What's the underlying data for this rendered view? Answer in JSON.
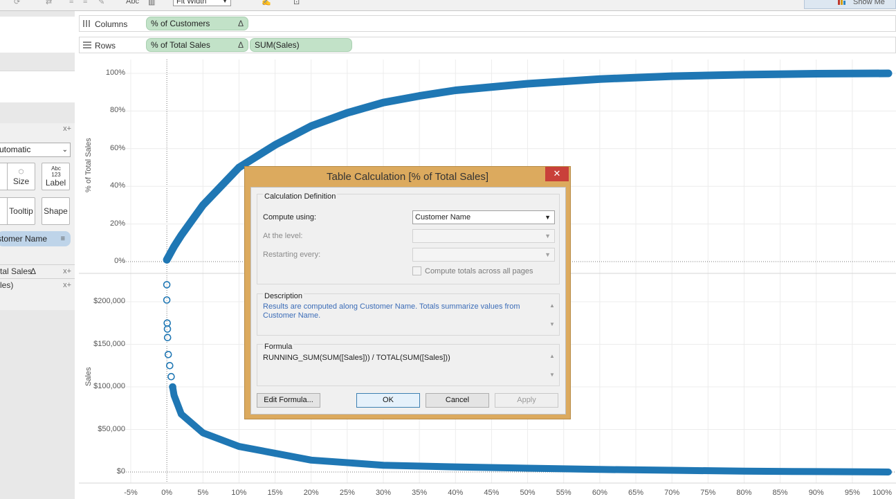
{
  "toolbar": {
    "fit_label": "Fit Width",
    "show_me_label": "Show Me",
    "abc_label": "Abc"
  },
  "left_panel": {
    "mark_type": "utomatic",
    "mark_buttons": [
      {
        "label": "Size",
        "icon": "size-icon"
      },
      {
        "label": "Label",
        "icon": "label-icon",
        "icon_text": "Abc 123"
      },
      {
        "label": "Tooltip",
        "icon": "tooltip-icon"
      },
      {
        "label": "Shape",
        "icon": "shape-icon"
      }
    ],
    "detail_pill": "stomer Name",
    "row_fields": [
      "tal Sales",
      "les)"
    ],
    "delta_glyph": "Δ",
    "add_glyph": "x+"
  },
  "shelves": {
    "columns_label": "Columns",
    "rows_label": "Rows",
    "columns_pills": [
      {
        "label": "% of Customers",
        "delta": "Δ"
      }
    ],
    "rows_pills": [
      {
        "label": "% of Total Sales",
        "delta": "Δ"
      },
      {
        "label": "SUM(Sales)",
        "delta": ""
      }
    ]
  },
  "view": {
    "top_axis_title": "% of Total Sales",
    "bottom_axis_title": "Sales",
    "top_y_ticks": [
      "100%",
      "80%",
      "60%",
      "40%",
      "20%",
      "0%"
    ],
    "bottom_y_ticks": [
      "$200,000",
      "$150,000",
      "$100,000",
      "$50,000",
      "$0"
    ],
    "x_ticks": [
      "-5%",
      "0%",
      "5%",
      "10%",
      "15%",
      "20%",
      "25%",
      "30%",
      "35%",
      "40%",
      "45%",
      "50%",
      "55%",
      "60%",
      "65%",
      "70%",
      "75%",
      "80%",
      "85%",
      "90%",
      "95%",
      "100%"
    ],
    "mark_color": "#1f77b4"
  },
  "chart_data": {
    "type": "scatter",
    "xlabel": "% of Customers",
    "series": [
      {
        "name": "% of Total Sales",
        "x": [
          0,
          0.01,
          0.02,
          0.05,
          0.1,
          0.15,
          0.2,
          0.25,
          0.3,
          0.35,
          0.4,
          0.5,
          0.6,
          0.7,
          0.8,
          0.9,
          1.0
        ],
        "y": [
          0.01,
          0.08,
          0.14,
          0.3,
          0.5,
          0.62,
          0.72,
          0.79,
          0.845,
          0.88,
          0.91,
          0.945,
          0.97,
          0.985,
          0.993,
          0.998,
          1.0
        ],
        "ylim": [
          0,
          1
        ]
      },
      {
        "name": "Sales",
        "x": [
          0,
          0,
          0.0005,
          0.0008,
          0.001,
          0.002,
          0.004,
          0.006,
          0.008,
          0.01,
          0.02,
          0.05,
          0.1,
          0.15,
          0.2,
          0.3,
          0.4,
          0.5,
          0.6,
          0.7,
          0.8,
          0.9,
          1.0
        ],
        "y": [
          220000,
          202000,
          175000,
          168000,
          158000,
          138000,
          125000,
          112000,
          100000,
          90000,
          68000,
          46000,
          30000,
          22000,
          14000,
          8000,
          6000,
          4500,
          3000,
          2000,
          1000,
          500,
          0
        ],
        "ylim": [
          0,
          230000
        ]
      }
    ],
    "xlim": [
      -0.05,
      1.0
    ]
  },
  "dialog": {
    "title": "Table Calculation [% of Total Sales]",
    "close_glyph": "✕",
    "calc_def_title": "Calculation Definition",
    "compute_using_label": "Compute using:",
    "compute_using_value": "Customer Name",
    "at_level_label": "At the level:",
    "restarting_label": "Restarting every:",
    "compute_totals_label": "Compute totals across all pages",
    "description_title": "Description",
    "description_text": "Results are computed along Customer Name.  Totals summarize values from Customer Name.",
    "formula_title": "Formula",
    "formula_text": "RUNNING_SUM(SUM([Sales])) / TOTAL(SUM([Sales]))",
    "buttons": {
      "edit_formula": "Edit Formula...",
      "ok": "OK",
      "cancel": "Cancel",
      "apply": "Apply"
    }
  }
}
